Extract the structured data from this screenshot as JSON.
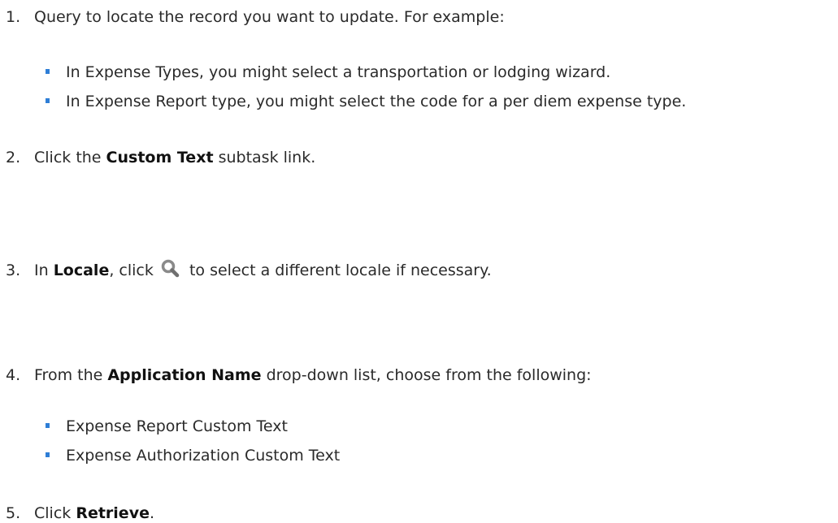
{
  "steps": [
    {
      "number": "1.",
      "text": "Query to locate the record you want to update. For example:",
      "bullets": [
        "In Expense Types, you might select a transportation or lodging wizard.",
        "In Expense Report type, you might select the code for a per diem expense type."
      ]
    },
    {
      "number": "2.",
      "pre": "Click the ",
      "ui": "Custom Text",
      "post": " subtask link."
    },
    {
      "number": "3.",
      "pre": "In ",
      "ui": "Locale",
      "mid": ", click ",
      "icon": "magnifier-icon",
      "post": " to select a different locale if necessary."
    },
    {
      "number": "4.",
      "pre": "From the ",
      "ui": "Application Name",
      "post": " drop-down list, choose from the following:",
      "bullets": [
        "Expense Report Custom Text",
        "Expense Authorization Custom Text"
      ]
    },
    {
      "number": "5.",
      "pre": "Click ",
      "ui": "Retrieve",
      "post": "."
    }
  ],
  "colors": {
    "text": "#2a2a2a",
    "bullet": "#2e7ed6",
    "icon": "#8a8a8a"
  }
}
